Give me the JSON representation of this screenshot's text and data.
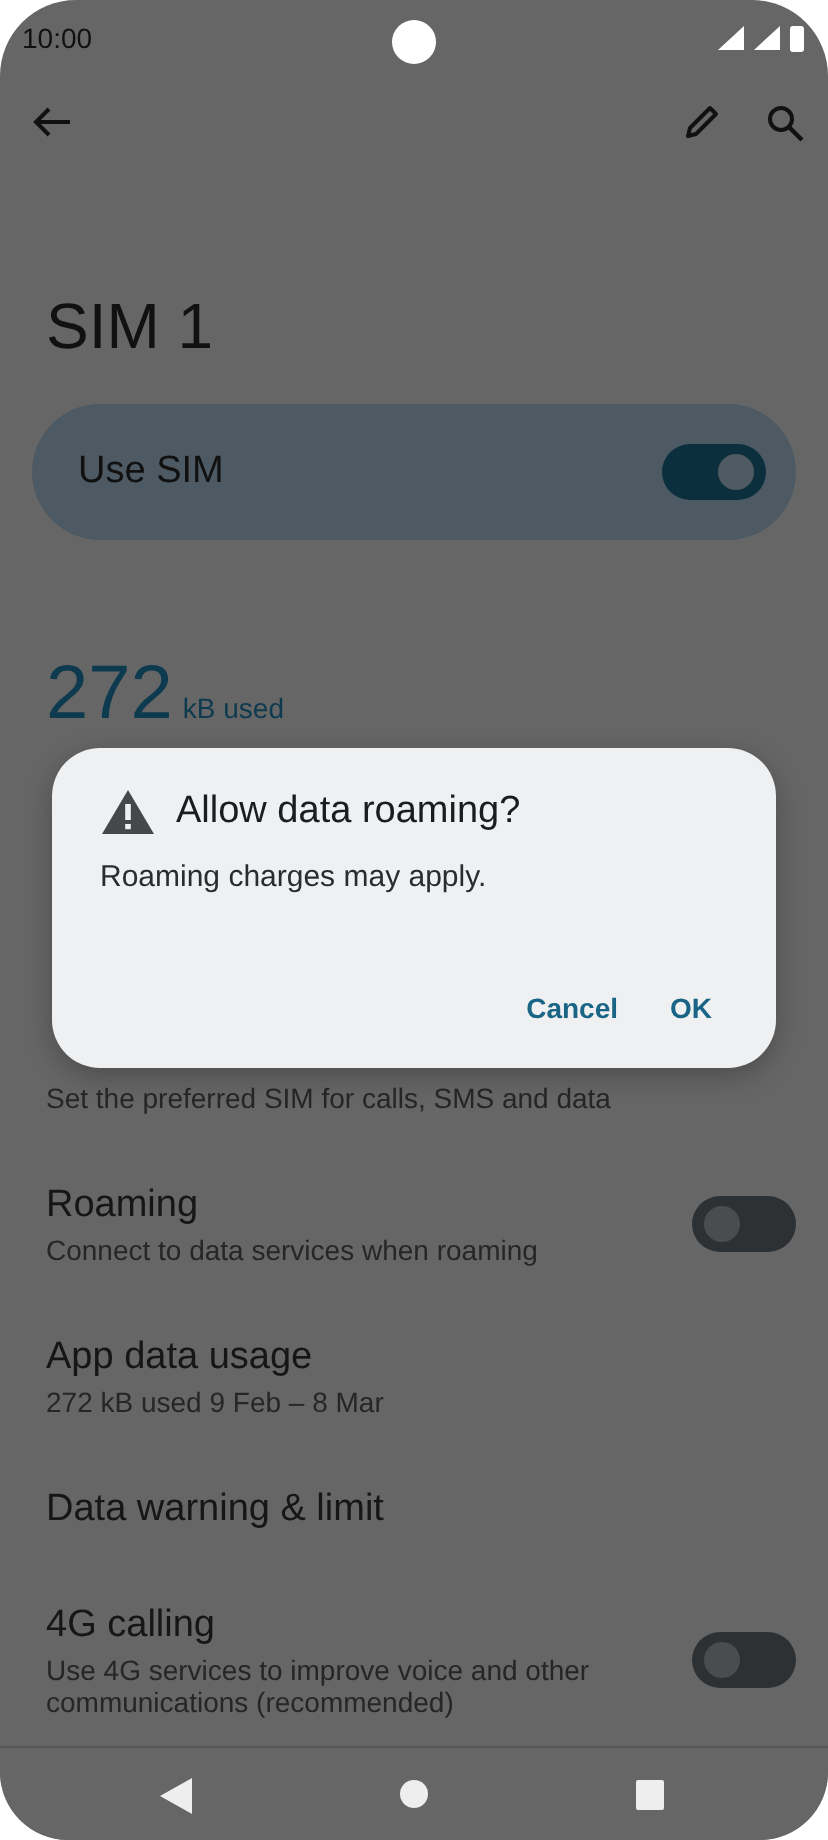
{
  "status_bar": {
    "time": "10:00"
  },
  "title": "SIM 1",
  "use_sim": {
    "label": "Use SIM",
    "on": true
  },
  "usage": {
    "amount": "272",
    "unit": "kB used"
  },
  "settings": [
    {
      "kind": "text",
      "subtitle": "Set the preferred SIM for calls, SMS and data"
    },
    {
      "kind": "switch",
      "title": "Roaming",
      "subtitle": "Connect to data services when roaming",
      "on": false
    },
    {
      "kind": "text",
      "title": "App data usage",
      "subtitle": "272 kB used 9 Feb – 8 Mar"
    },
    {
      "kind": "text",
      "title": "Data warning & limit"
    },
    {
      "kind": "switch",
      "title": "4G calling",
      "subtitle": "Use 4G services to improve voice and other communications (recommended)",
      "on": false
    }
  ],
  "dialog": {
    "title": "Allow data roaming?",
    "message": "Roaming charges may apply.",
    "buttons": [
      "Cancel",
      "OK"
    ]
  }
}
